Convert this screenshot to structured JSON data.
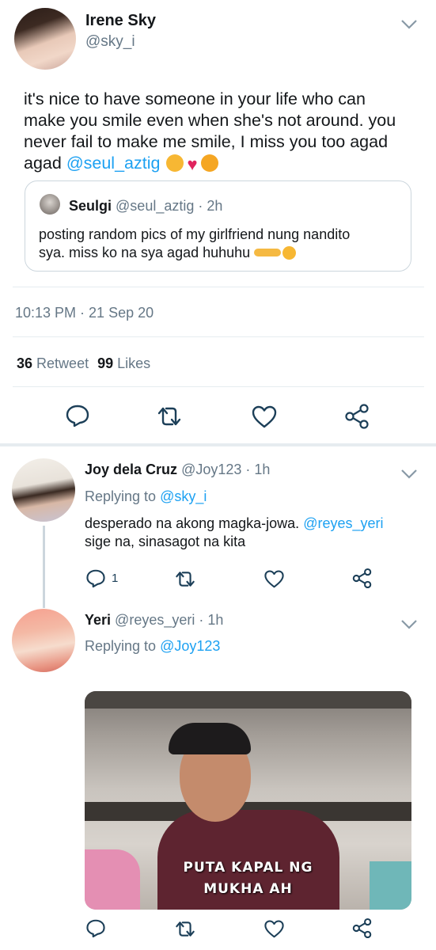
{
  "tweet": {
    "author_name": "Irene Sky",
    "author_handle": "@sky_i",
    "text_line1": "it's nice to have someone in your life who can",
    "text_line2": "make you smile even when she's not around. you",
    "text_line3": "never fail to make me smile, I miss you too agad",
    "text_line4_prefix": "agad ",
    "mention": "@seul_aztig",
    "timestamp": "10:13 PM · 21 Sep 20",
    "retweet_count": "36",
    "retweet_label": "Retweet",
    "like_count": "99",
    "like_label": "Likes"
  },
  "quoted": {
    "author_name": "Seulgi",
    "author_handle": "@seul_aztig",
    "age": "· 2h",
    "text_line1": "posting random pics of my girlfriend nung nandito",
    "text_line2": "sya. miss ko na sya agad huhuhu"
  },
  "replies": [
    {
      "author_name": "Joy dela Cruz",
      "author_handle": "@Joy123",
      "age": "· 1h",
      "replying_prefix": "Replying to ",
      "replying_to": "@sky_i",
      "text_line1": "desperado na akong magka-jowa. ",
      "mention": "@reyes_yeri",
      "text_line2": "sige na, sinasagot na kita",
      "reply_count": "1"
    },
    {
      "author_name": "Yeri",
      "author_handle": "@reyes_yeri",
      "age": "· 1h",
      "replying_prefix": "Replying to ",
      "replying_to": "@Joy123",
      "image_caption_line1": "PUTA KAPAL NG",
      "image_caption_line2": "MUKHA AH"
    }
  ],
  "icons": [
    "chevron-down-icon",
    "reply-icon",
    "retweet-icon",
    "like-icon",
    "share-icon"
  ],
  "colors": {
    "link": "#1da1f2",
    "muted": "#657786",
    "text": "#14171a",
    "divider": "#e6ecf0"
  }
}
